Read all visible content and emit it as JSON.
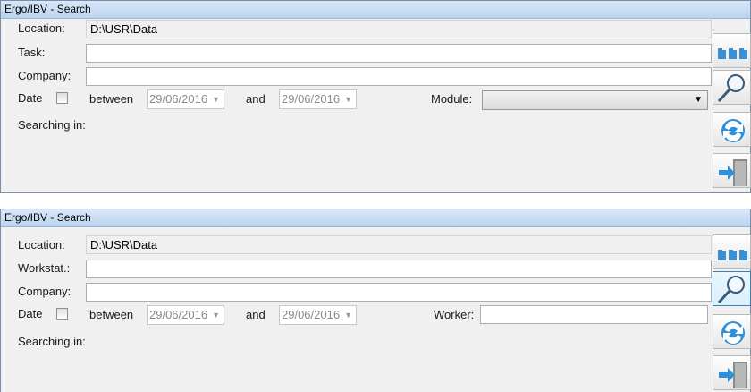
{
  "window1": {
    "title": "Ergo/IBV - Search",
    "location_label": "Location:",
    "location_value": "D:\\USR\\Data",
    "row2_label": "Task:",
    "row2_value": "",
    "company_label": "Company:",
    "company_value": "",
    "date_label": "Date",
    "date_checked": false,
    "between_label": "between",
    "date_from": "29/06/2016",
    "and_label": "and",
    "date_to": "29/06/2016",
    "extra_label": "Module:",
    "extra_value": "",
    "searching_label": "Searching in:"
  },
  "window2": {
    "title": "Ergo/IBV - Search",
    "location_label": "Location:",
    "location_value": "D:\\USR\\Data",
    "row2_label": "Workstat.:",
    "row2_value": "",
    "company_label": "Company:",
    "company_value": "",
    "date_label": "Date",
    "date_checked": false,
    "between_label": "between",
    "date_from": "29/06/2016",
    "and_label": "and",
    "date_to": "29/06/2016",
    "extra_label": "Worker:",
    "extra_value": "",
    "searching_label": "Searching in:"
  },
  "side_buttons": [
    {
      "icon": "folders-icon"
    },
    {
      "icon": "magnifier-icon"
    },
    {
      "icon": "refresh-icon"
    },
    {
      "icon": "exit-door-icon"
    }
  ],
  "colors": {
    "title_bar": "#c8dbf0",
    "window_bg": "#f0f0f0",
    "icon_blue": "#3c8fd0"
  }
}
